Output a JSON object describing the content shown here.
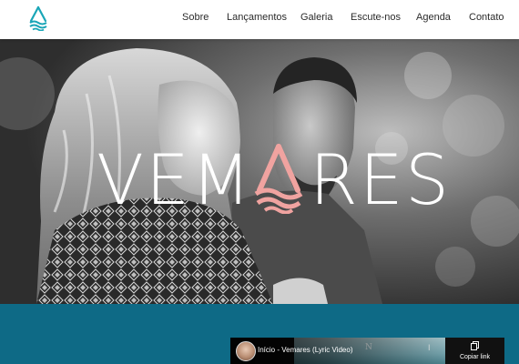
{
  "nav": {
    "items": [
      {
        "label": "Sobre"
      },
      {
        "label": "Lançamentos"
      },
      {
        "label": "Galeria"
      },
      {
        "label": "Escute-nos"
      },
      {
        "label": "Agenda"
      },
      {
        "label": "Contato"
      }
    ]
  },
  "logo": {
    "icon": "wave-triangle-logo-icon",
    "color": "#1aa6b7"
  },
  "hero": {
    "title_parts": [
      "VEM",
      "RES"
    ],
    "title_letter_icon": "pink-wave-triangle-icon",
    "accent_color": "#f0a3a0",
    "photo": "black-and-white-couple-photo"
  },
  "band": {
    "color": "#0e6a86"
  },
  "video": {
    "title": "Início - Vemares (Lyric Video)",
    "copy_label": "Copiar link",
    "copy_icon": "copy-icon"
  }
}
